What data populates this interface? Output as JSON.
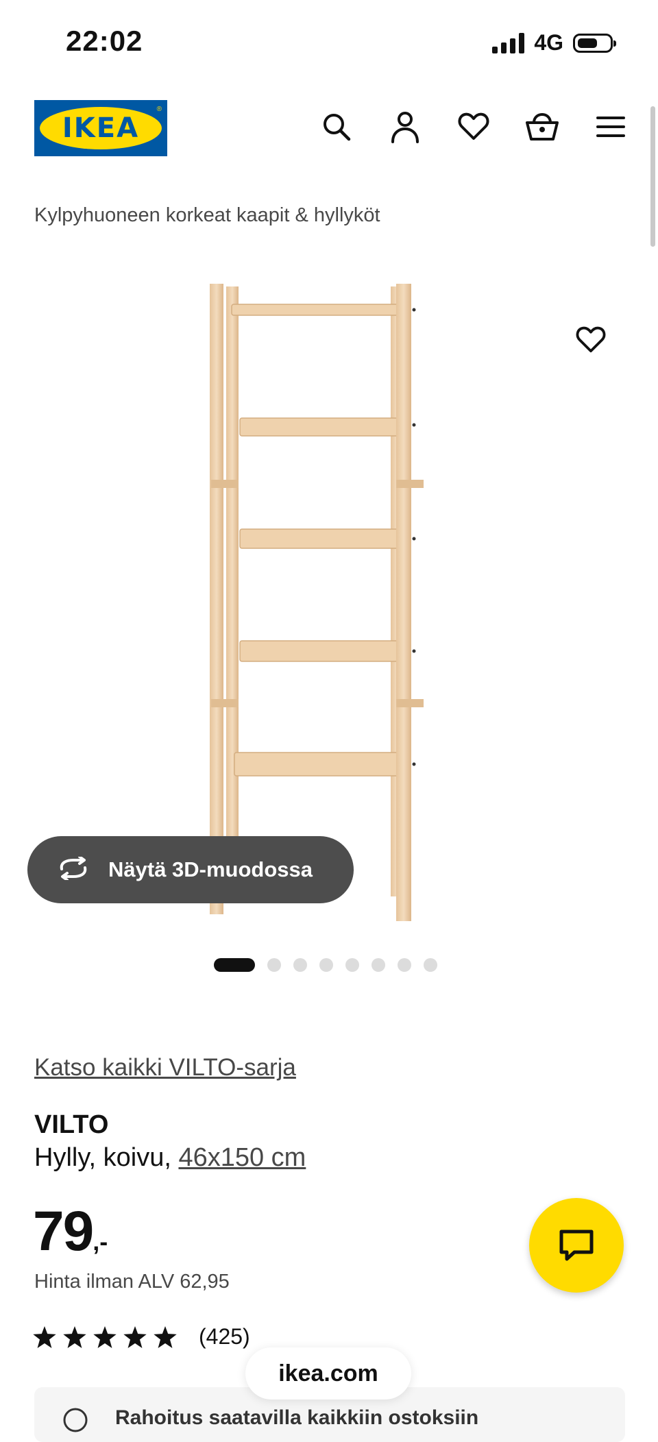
{
  "status_bar": {
    "time": "22:02",
    "network": "4G"
  },
  "header": {
    "logo_text": "IKEA",
    "icons": [
      "search-icon",
      "account-icon",
      "heart-icon",
      "basket-icon",
      "menu-icon"
    ]
  },
  "breadcrumb": "Kylpyhuoneen korkeat kaapit & hyllyköt",
  "gallery": {
    "view_3d_label": "Näytä 3D-muodossa",
    "image_count": 8,
    "active_index": 0
  },
  "product": {
    "series_link": "Katso kaikki VILTO-sarja",
    "name": "VILTO",
    "description_prefix": "Hylly, koivu, ",
    "size": "46x150 cm",
    "price_integer": "79",
    "price_suffix": ",-",
    "vat_text": "Hinta ilman ALV 62,95",
    "rating_stars": 5,
    "review_count": "(425)"
  },
  "finance_banner": {
    "text": "Rahoitus saatavilla kaikkiin ostoksiin"
  },
  "browser": {
    "url": "ikea.com"
  },
  "colors": {
    "ikea_blue": "#0058A3",
    "ikea_yellow": "#FFDB00",
    "button_dark": "#4d4d4d",
    "text": "#111111"
  }
}
